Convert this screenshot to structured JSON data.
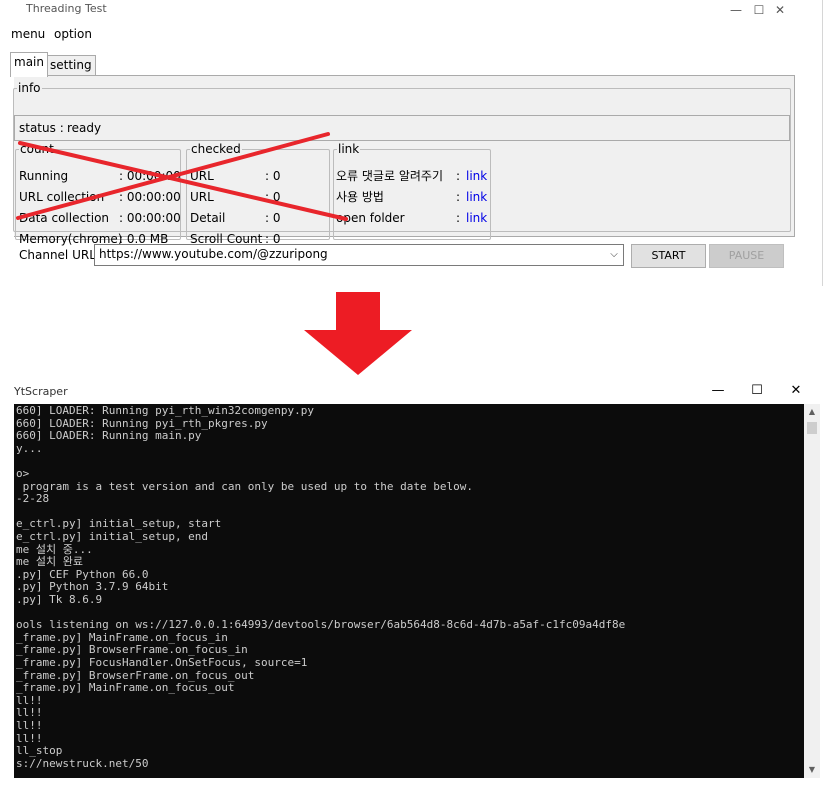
{
  "top_window": {
    "title": "Threading Test",
    "menu": [
      "menu",
      "option"
    ],
    "tabs": [
      "main",
      "setting"
    ],
    "info": {
      "legend": "info",
      "status_label": "status :",
      "status_value": "ready"
    },
    "count": {
      "legend": "count",
      "rows": [
        {
          "label": "Running",
          "value": ": 00:00:00"
        },
        {
          "label": "URL collection",
          "value": ": 00:00:00"
        },
        {
          "label": "Data collection",
          "value": ": 00:00:00"
        },
        {
          "label": "Memory(chrome)",
          "value": ": 0.0 MB"
        }
      ]
    },
    "checked": {
      "legend": "checked",
      "rows": [
        {
          "label": "URL",
          "value": ": 0"
        },
        {
          "label": "URL",
          "value": ": 0"
        },
        {
          "label": "Detail",
          "value": ": 0"
        },
        {
          "label": "Scroll Count",
          "value": ": 0"
        }
      ]
    },
    "link": {
      "legend": "link",
      "rows": [
        {
          "label": "오류 댓글로 알려주기",
          "value": ": ",
          "link": "link"
        },
        {
          "label": "사용 방법",
          "value": ": ",
          "link": "link"
        },
        {
          "label": "open folder",
          "value": ": ",
          "link": "link"
        }
      ]
    },
    "channel_label": "Channel URL :",
    "channel_value": "https://www.youtube.com/@zzuripong",
    "start_label": "START",
    "pause_label": "PAUSE",
    "window_buttons": [
      "—",
      "☐",
      "✕"
    ]
  },
  "arrow_color": "#ed1c24",
  "cross_color": "#e8262c",
  "console_window": {
    "title": "YtScraper",
    "window_buttons": [
      "—",
      "☐",
      "✕"
    ],
    "lines": [
      "660] LOADER: Running pyi_rth_win32comgenpy.py",
      "660] LOADER: Running pyi_rth_pkgres.py",
      "660] LOADER: Running main.py",
      "y...",
      "",
      "o>",
      " program is a test version and can only be used up to the date below.",
      "-2-28",
      "",
      "e_ctrl.py] initial_setup, start",
      "e_ctrl.py] initial_setup, end",
      "me 설치 중...",
      "me 설치 완료",
      ".py] CEF Python 66.0",
      ".py] Python 3.7.9 64bit",
      ".py] Tk 8.6.9",
      "",
      "ools listening on ws://127.0.0.1:64993/devtools/browser/6ab564d8-8c6d-4d7b-a5af-c1fc09a4df8e",
      "_frame.py] MainFrame.on_focus_in",
      "_frame.py] BrowserFrame.on_focus_in",
      "_frame.py] FocusHandler.OnSetFocus, source=1",
      "_frame.py] BrowserFrame.on_focus_out",
      "_frame.py] MainFrame.on_focus_out",
      "ll!!",
      "ll!!",
      "ll!!",
      "ll!!",
      "ll_stop",
      "s://newstruck.net/50"
    ]
  }
}
